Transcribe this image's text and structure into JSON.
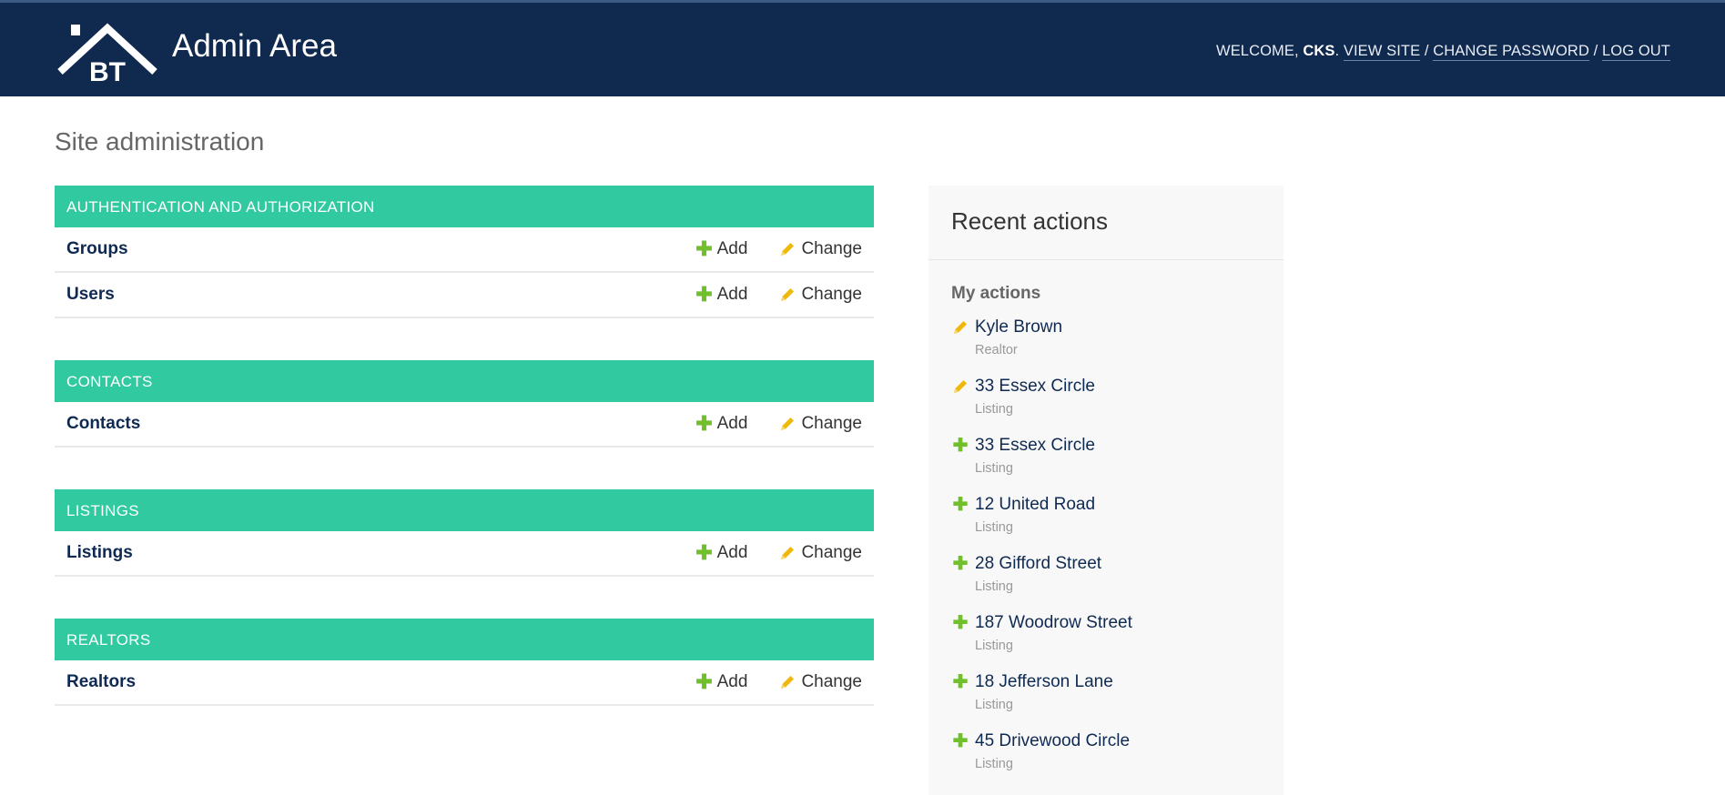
{
  "header": {
    "brand": "Admin Area",
    "logo_text": "BT",
    "welcome": "WELCOME, ",
    "user": "CKS",
    "after_user": ". ",
    "view_site": "VIEW SITE",
    "sep": " / ",
    "change_password": "CHANGE PASSWORD",
    "log_out": "LOG OUT"
  },
  "page_title": "Site administration",
  "labels": {
    "add": "Add",
    "change": "Change"
  },
  "modules": [
    {
      "caption": "AUTHENTICATION AND AUTHORIZATION",
      "rows": [
        "Groups",
        "Users"
      ]
    },
    {
      "caption": "CONTACTS",
      "rows": [
        "Contacts"
      ]
    },
    {
      "caption": "LISTINGS",
      "rows": [
        "Listings"
      ]
    },
    {
      "caption": "REALTORS",
      "rows": [
        "Realtors"
      ]
    }
  ],
  "recent": {
    "title": "Recent actions",
    "subtitle": "My actions",
    "items": [
      {
        "title": "Kyle Brown",
        "type": "Realtor",
        "action": "change"
      },
      {
        "title": "33 Essex Circle",
        "type": "Listing",
        "action": "change"
      },
      {
        "title": "33 Essex Circle",
        "type": "Listing",
        "action": "add"
      },
      {
        "title": "12 United Road",
        "type": "Listing",
        "action": "add"
      },
      {
        "title": "28 Gifford Street",
        "type": "Listing",
        "action": "add"
      },
      {
        "title": "187 Woodrow Street",
        "type": "Listing",
        "action": "add"
      },
      {
        "title": "18 Jefferson Lane",
        "type": "Listing",
        "action": "add"
      },
      {
        "title": "45 Drivewood Circle",
        "type": "Listing",
        "action": "add"
      }
    ]
  },
  "colors": {
    "header": "#10294f",
    "caption": "#30c9a0",
    "add": "#70bf2b",
    "change": "#efb80b"
  }
}
